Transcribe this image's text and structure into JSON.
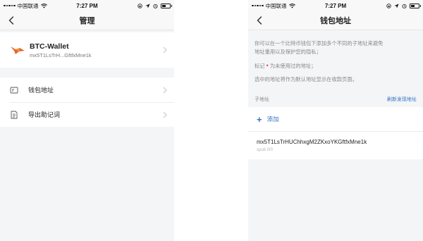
{
  "status": {
    "carrier": "中国联通",
    "time": "7:27 PM"
  },
  "left": {
    "nav_title": "管理",
    "wallet": {
      "name": "BTC-Wallet",
      "address": "mx5T1LsTrH...GftfxMne1k"
    },
    "menu": [
      {
        "label": "钱包地址",
        "icon": "wallet-address-icon"
      },
      {
        "label": "导出助记词",
        "icon": "document-icon"
      }
    ]
  },
  "right": {
    "nav_title": "钱包地址",
    "description": {
      "line1": "你可以在一个比特币钱包下添加多个不同的子地址来避免",
      "line2": "地址重用以及保护您的隐私；",
      "mark_prefix": "标记",
      "mark_suffix": "为未使用过的地址；",
      "line4": "选中的地址将作为默认地址显示在收款页面。"
    },
    "section_title": "子地址",
    "refresh_label": "刷新发现地址",
    "add_label": "添加",
    "addresses": [
      {
        "address": "mx5T1LsTrHUChhxgM2ZKxoYKGftfxMne1k",
        "path": "xpub 0/0"
      }
    ]
  },
  "colors": {
    "accent": "#3576c2",
    "unused_dot": "#e0443c",
    "wallet_logo": "#e8672c"
  }
}
